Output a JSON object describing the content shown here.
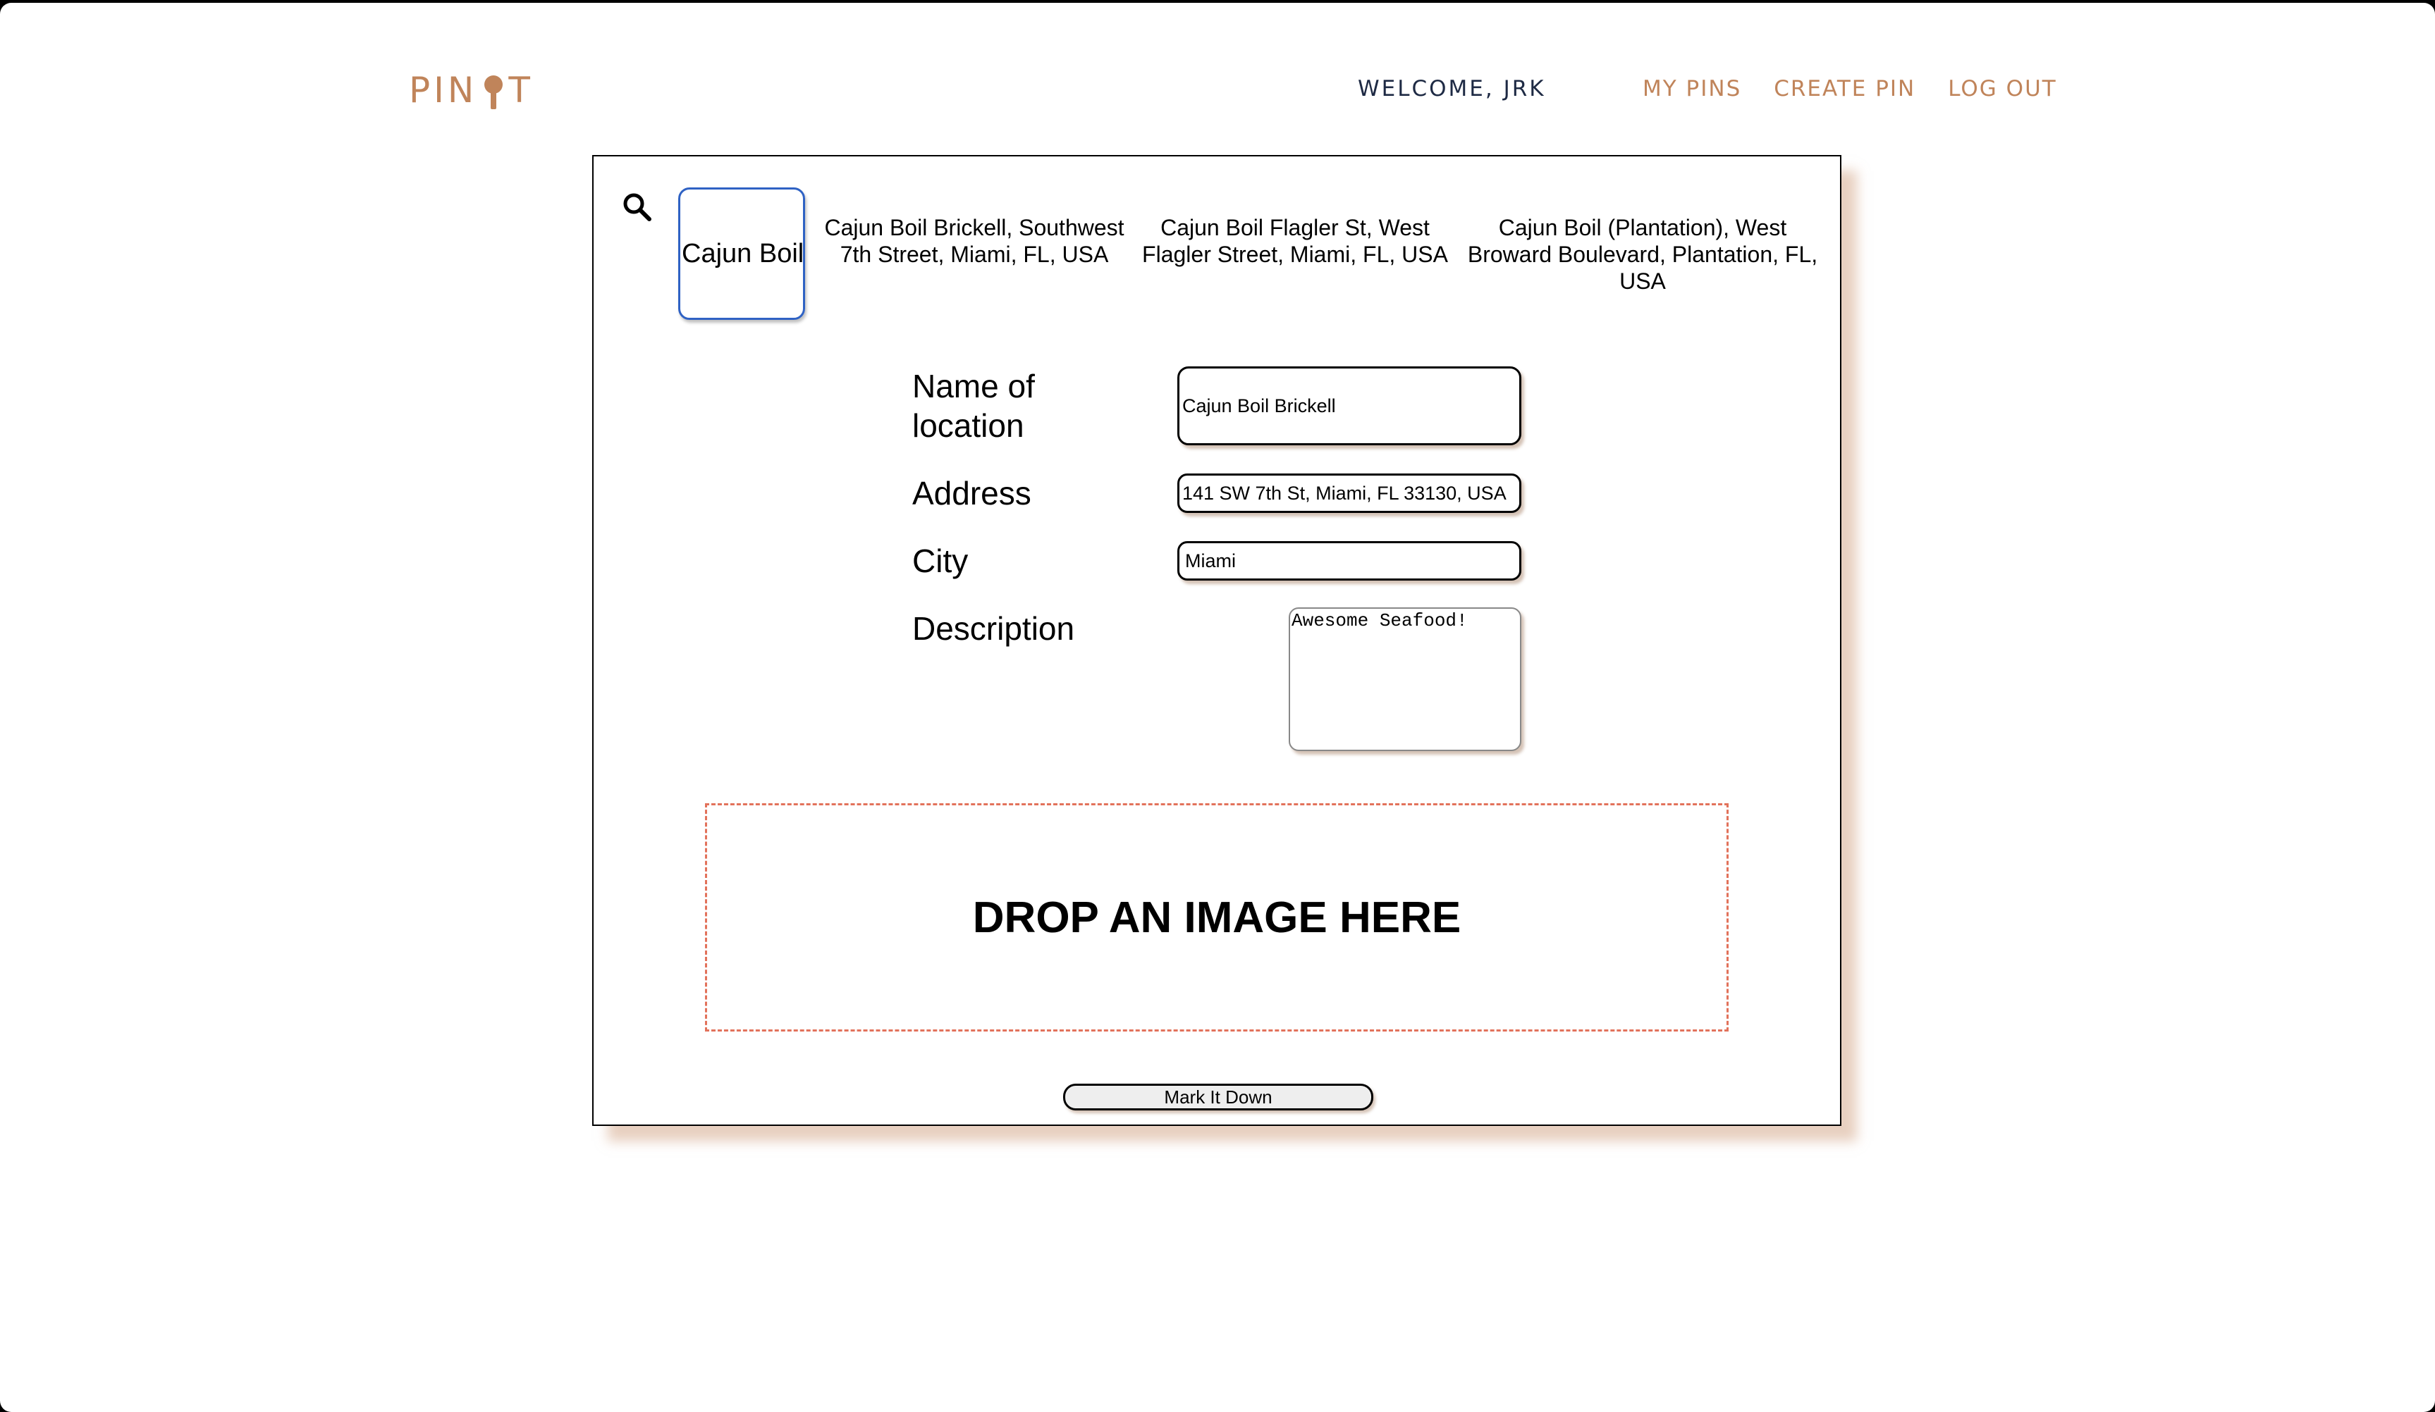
{
  "header": {
    "logo_left": "PIN",
    "logo_right": "T",
    "welcome": "WELCOME, JRK",
    "nav": {
      "my_pins": "MY PINS",
      "create_pin": "CREATE PIN",
      "log_out": "LOG OUT"
    }
  },
  "search": {
    "icon": "search-icon",
    "query": "Cajun Boil",
    "suggestions": [
      "Cajun Boil Brickell, Southwest 7th Street, Miami, FL, USA",
      "Cajun Boil Flagler St, West Flagler Street, Miami, FL, USA",
      "Cajun Boil (Plantation), West Broward Boulevard, Plantation, FL, USA"
    ]
  },
  "form": {
    "name_label": "Name of location",
    "name_value": "Cajun Boil Brickell",
    "address_label": "Address",
    "address_value": "141 SW 7th St, Miami, FL 33130, USA",
    "city_label": "City",
    "city_value": "Miami",
    "description_label": "Description",
    "description_value": "Awesome Seafood!",
    "drop_zone": "DROP AN IMAGE HERE",
    "submit": "Mark It Down"
  },
  "colors": {
    "brand": "#c0845a",
    "welcome_text": "#1e2a44",
    "active_border": "#2f62c4",
    "drop_zone_border": "#e2725b"
  }
}
